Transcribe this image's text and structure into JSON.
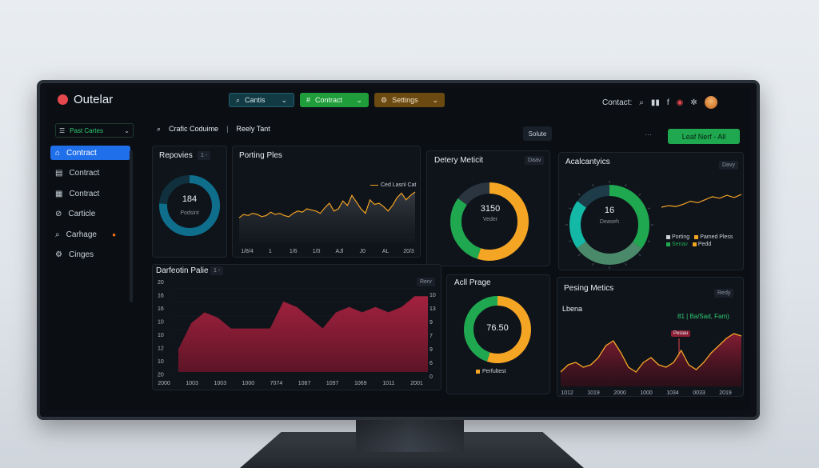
{
  "app": {
    "title": "Outelar"
  },
  "toolbar": {
    "cantis_label": "Cantis",
    "contract_label": "Contract",
    "settings_label": "Settings",
    "cantis_color": "#123a44",
    "contract_color": "#1f9d3a",
    "settings_color": "#6b4a12"
  },
  "header": {
    "contact_label": "Contact:"
  },
  "sidebar": {
    "filter_label": "Past Cartes",
    "items": [
      {
        "label": "Contract",
        "icon": "user-icon",
        "active": true
      },
      {
        "label": "Contract",
        "icon": "list-icon",
        "active": false
      },
      {
        "label": "Contract",
        "icon": "calendar-icon",
        "active": false
      },
      {
        "label": "Carticle",
        "icon": "link-icon",
        "active": false
      },
      {
        "label": "Carhage",
        "icon": "search-icon",
        "active": false,
        "badge": "●"
      },
      {
        "label": "Cinges",
        "icon": "settings-icon",
        "active": false
      }
    ]
  },
  "search": {
    "value": "Crafic Coduime",
    "secondary": "Reely Tant"
  },
  "actions": {
    "solute_label": "Solute",
    "more_label": "···",
    "primary_label": "Leaf Nerf - All"
  },
  "panels": {
    "repovies": {
      "title": "Repovies",
      "tag": "1 -",
      "donut": {
        "value": "184",
        "label": "Podsint",
        "fraction": 0.76,
        "color": "#0e6e8c",
        "track": "#11303d"
      }
    },
    "porting": {
      "title": "Porting Ples",
      "legend": "Ced Lasnl Cat",
      "chart_data": {
        "type": "area",
        "x_ticks": [
          "1/8/4",
          "1",
          "1/6",
          "1/0",
          "AJl",
          "J0",
          "AL",
          "20/3"
        ],
        "values": [
          22,
          25,
          24,
          26,
          25,
          23,
          24,
          27,
          25,
          26,
          24,
          23,
          26,
          28,
          27,
          30,
          29,
          28,
          26,
          31,
          35,
          28,
          30,
          37,
          33,
          42,
          36,
          30,
          26,
          38,
          34,
          35,
          32,
          28,
          33,
          40,
          44,
          38,
          42,
          45
        ],
        "ylim": [
          0,
          50
        ],
        "color": "#f0a020"
      }
    },
    "delivery": {
      "title": "Detery Meticit",
      "tag": "Daav",
      "donut": {
        "value": "3150",
        "label": "Veder",
        "segments": [
          {
            "fraction": 0.55,
            "color": "#f5a524"
          },
          {
            "fraction": 0.3,
            "color": "#1fa84f"
          },
          {
            "fraction": 0.15,
            "color": "#2b3540"
          }
        ]
      }
    },
    "analytics": {
      "title": "Acalcantyics",
      "tag": "Davy",
      "donut": {
        "value": "16",
        "label": "Deaseh",
        "segments": [
          {
            "fraction": 0.35,
            "color": "#1fa84f"
          },
          {
            "fraction": 0.3,
            "color": "#4a8a6a"
          },
          {
            "fraction": 0.2,
            "color": "#14b8a6"
          },
          {
            "fraction": 0.15,
            "color": "#1d3b49"
          }
        ]
      },
      "legend": [
        {
          "label": "Porting",
          "color": "#c9d1d9"
        },
        {
          "label": "Pamed Pless",
          "color": "#f5a524"
        },
        {
          "label": "Senav",
          "color": "#1fa84f"
        },
        {
          "label": "Pedd",
          "color": "#f5a524"
        }
      ],
      "chart_data": {
        "type": "line",
        "values": [
          30,
          32,
          31,
          34,
          38,
          36,
          40,
          44,
          42,
          46,
          43,
          47
        ],
        "ylim": [
          0,
          60
        ],
        "color": "#f5a524"
      }
    },
    "distribution": {
      "title": "Darfeotin Palie",
      "tag": "1 -",
      "view_tag": "Rerv",
      "chart_data": {
        "type": "area",
        "y_left": [
          "20",
          "16",
          "16",
          "10",
          "10",
          "12",
          "10",
          "20"
        ],
        "y_right": [
          "10",
          "13",
          "9",
          "7",
          "9",
          "6",
          "0"
        ],
        "x_ticks": [
          "2000",
          "1003",
          "1003",
          "1000",
          "7074",
          "1087",
          "1097",
          "1069",
          "1011",
          "2001"
        ],
        "values": [
          4,
          9,
          11,
          10,
          8,
          8,
          8,
          8,
          13,
          12,
          10,
          8,
          11,
          12,
          11,
          12,
          11,
          12,
          14,
          14
        ],
        "ylim": [
          0,
          16
        ],
        "color": "#8b1e35"
      }
    },
    "progress": {
      "title": "Acll Prage",
      "donut": {
        "value": "76.50",
        "fraction": 0.55,
        "color": "#f5a524",
        "track": "#1fa84f"
      },
      "legend": "Perfultest"
    },
    "pesing": {
      "title": "Pesing Metics",
      "tag": "Redy",
      "subtitle": "Lbena",
      "stat": "81 | Ba/Sad, Fam)",
      "marker": "Pesiau",
      "chart_data": {
        "type": "area",
        "x_ticks": [
          "1012",
          "1019",
          "2000",
          "1000",
          "1034",
          "0033",
          "2019"
        ],
        "values": [
          6,
          9,
          10,
          8,
          9,
          12,
          17,
          19,
          14,
          8,
          6,
          10,
          12,
          9,
          8,
          10,
          15,
          9,
          7,
          10,
          14,
          17,
          20,
          22,
          21
        ],
        "ylim": [
          0,
          26
        ],
        "color": "#f5a524"
      }
    }
  }
}
